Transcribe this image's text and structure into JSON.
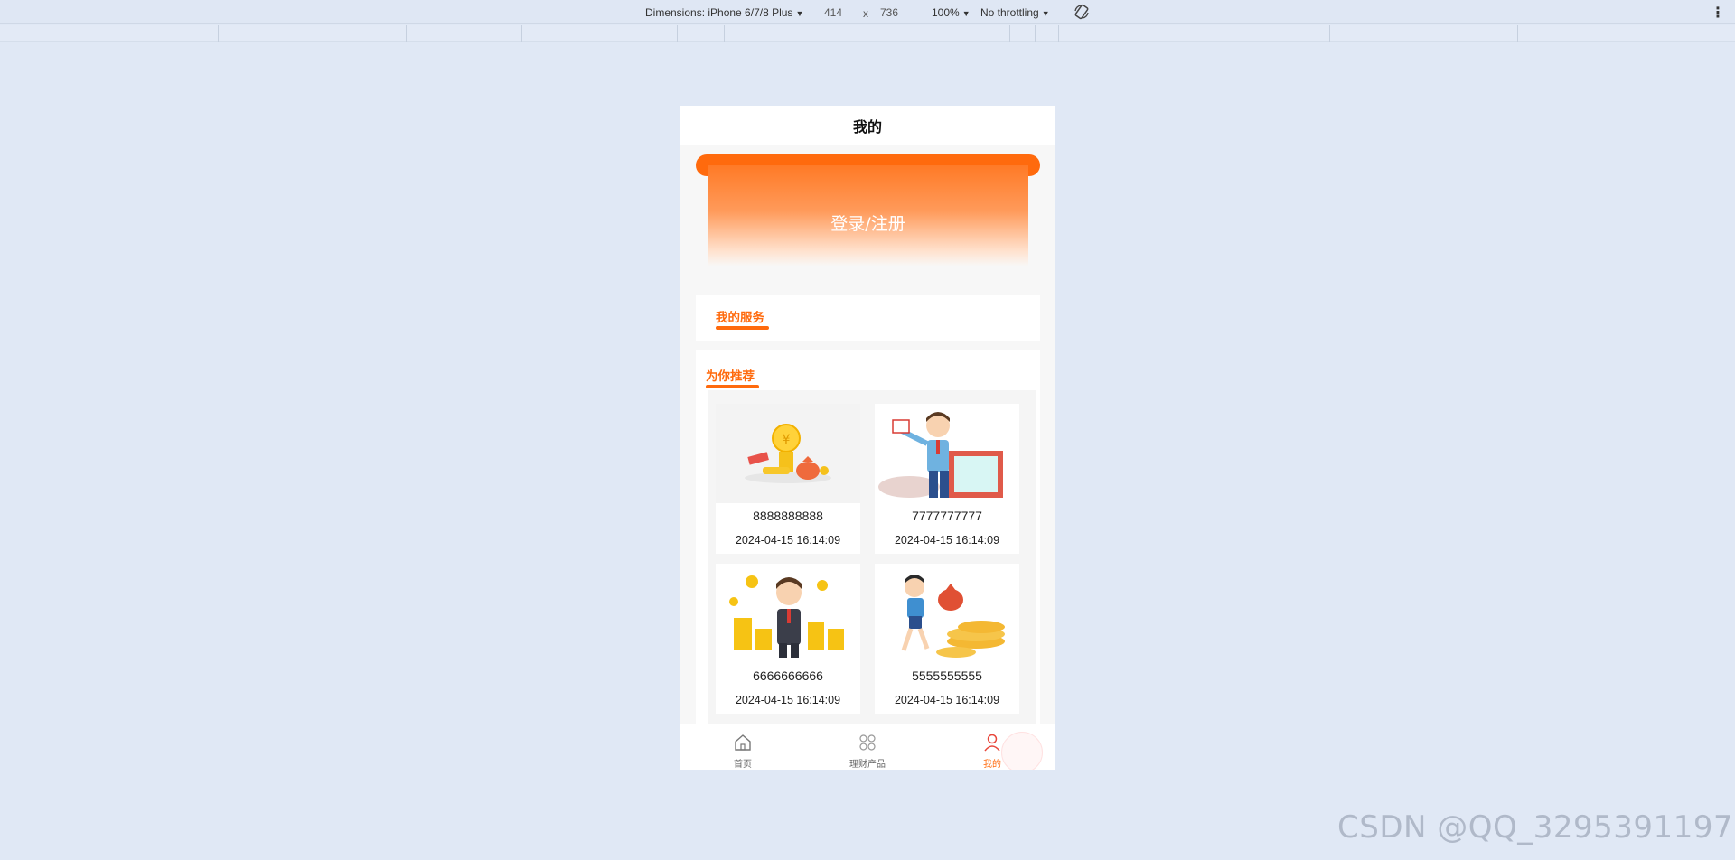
{
  "devtools": {
    "dimensions_label": "Dimensions: iPhone 6/7/8 Plus",
    "width_value": "414",
    "times": "x",
    "height_value": "736",
    "zoom": "100%",
    "throttling": "No throttling",
    "caret": "▼",
    "menu_icon": "⋮"
  },
  "page": {
    "title": "我的"
  },
  "login": {
    "label": "登录/注册"
  },
  "services": {
    "title": "我的服务"
  },
  "recommend": {
    "title": "为你推荐",
    "products": [
      {
        "name": "8888888888",
        "date": "2024-04-15 16:14:09",
        "image": "gold-coin-money-bag-illustration"
      },
      {
        "name": "7777777777",
        "date": "2024-04-15 16:14:09",
        "image": "businessman-with-board-illustration"
      },
      {
        "name": "6666666666",
        "date": "2024-04-15 16:14:09",
        "image": "businessman-with-coin-stacks-illustration"
      },
      {
        "name": "5555555555",
        "date": "2024-04-15 16:14:09",
        "image": "boy-with-coins-illustration"
      }
    ]
  },
  "tabbar": {
    "items": [
      {
        "label": "首页",
        "icon": "home-icon"
      },
      {
        "label": "理财产品",
        "icon": "grid-icon"
      },
      {
        "label": "我的",
        "icon": "user-icon",
        "active": true
      }
    ]
  },
  "colors": {
    "accent": "#ff6a0d",
    "background": "#e0e8f5"
  },
  "watermark": "CSDN @QQ_3295391197"
}
